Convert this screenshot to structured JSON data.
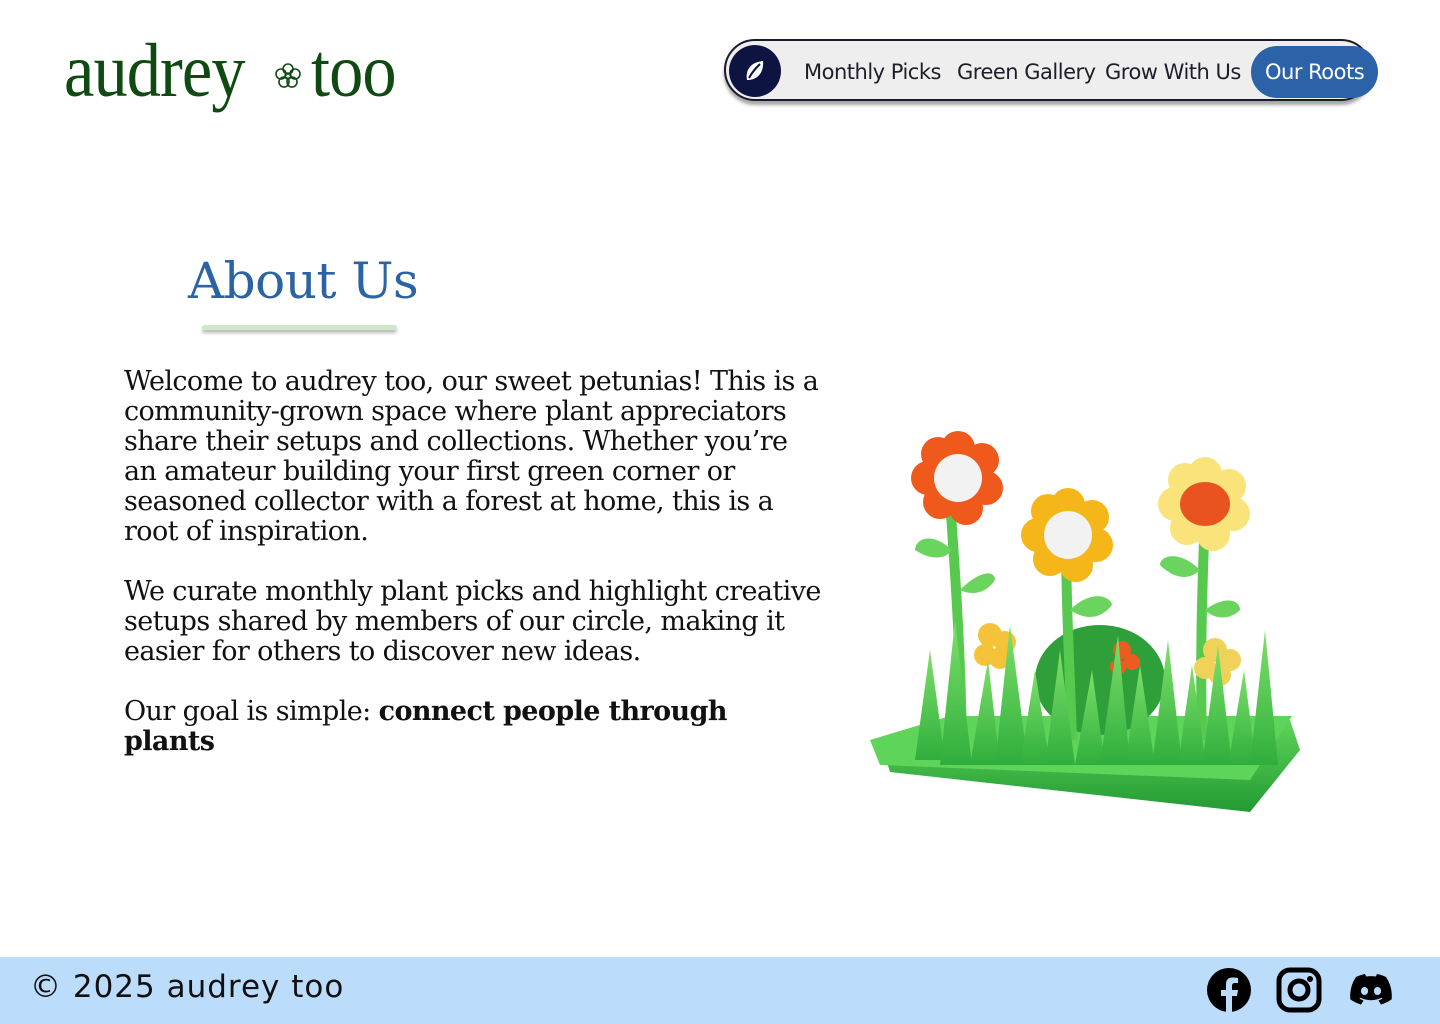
{
  "brand": {
    "word1": "audrey",
    "word2": "too"
  },
  "nav": {
    "items": [
      {
        "label": "Monthly Picks"
      },
      {
        "label": "Green Gallery"
      },
      {
        "label": "Grow With Us"
      },
      {
        "label": "Our Roots",
        "active": true
      }
    ]
  },
  "about": {
    "title": "About Us",
    "p1": "Welcome to audrey too, our sweet petunias! This is a community-grown space where plant appreciators share their setups and collections. Whether you’re an amateur building your first green corner or seasoned collector with a forest at home, this is a root of inspiration.",
    "p2": "We curate monthly plant picks and highlight creative setups shared by members of our circle, making it easier for others to discover new ideas.",
    "p3_lead": "Our goal is simple: ",
    "p3_bold": "connect people through plants"
  },
  "footer": {
    "copyright": "© 2025 audrey too",
    "social": [
      "facebook-icon",
      "instagram-icon",
      "discord-icon"
    ]
  },
  "colors": {
    "brand_green": "#0f4a12",
    "accent_blue": "#2c63a3",
    "nav_active": "#2b62a8",
    "footer_bg": "#bcdcfb"
  }
}
